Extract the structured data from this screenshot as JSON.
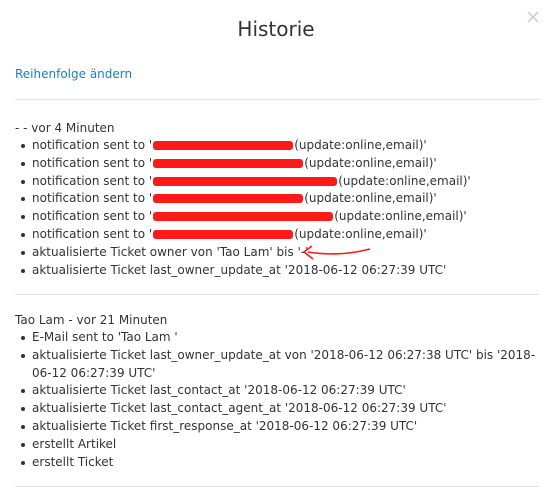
{
  "modal": {
    "title": "Historie",
    "order_link": "Reihenfolge ändern",
    "close_icon": "close-icon"
  },
  "groups": [
    {
      "header": "- - vor 4 Minuten",
      "entries": [
        {
          "prefix": "notification sent to '",
          "redacted": true,
          "suffix": "(update:online,email)'"
        },
        {
          "prefix": "notification sent to '",
          "redacted": true,
          "suffix": "(update:online,email)'"
        },
        {
          "prefix": "notification sent to '",
          "redacted": true,
          "suffix": "(update:online,email)'"
        },
        {
          "prefix": "notification sent to '",
          "redacted": true,
          "suffix": "(update:online,email)'"
        },
        {
          "prefix": "notification sent to '",
          "redacted": true,
          "suffix": "(update:online,email)'"
        },
        {
          "prefix": "notification sent to '",
          "redacted": true,
          "suffix": "(update:online,email)'"
        },
        {
          "text": "aktualisierte Ticket owner von 'Tao Lam' bis '-'"
        },
        {
          "text": "aktualisierte Ticket last_owner_update_at '2018-06-12 06:27:39 UTC'"
        }
      ]
    },
    {
      "header": "Tao Lam - vor 21 Minuten",
      "entries": [
        {
          "text": "E-Mail sent to 'Tao Lam '"
        },
        {
          "text": "aktualisierte Ticket last_owner_update_at von '2018-06-12 06:27:38 UTC' bis '2018-06-12 06:27:39 UTC'"
        },
        {
          "text": "aktualisierte Ticket last_contact_at '2018-06-12 06:27:39 UTC'"
        },
        {
          "text": "aktualisierte Ticket last_contact_agent_at '2018-06-12 06:27:39 UTC'"
        },
        {
          "text": "aktualisierte Ticket first_response_at '2018-06-12 06:27:39 UTC'"
        },
        {
          "text": "erstellt Artikel"
        },
        {
          "text": "erstellt Ticket"
        }
      ]
    }
  ],
  "colors": {
    "link": "#1a7fc1",
    "redaction": "#ff1a1a",
    "divider": "#e2e2e2"
  }
}
